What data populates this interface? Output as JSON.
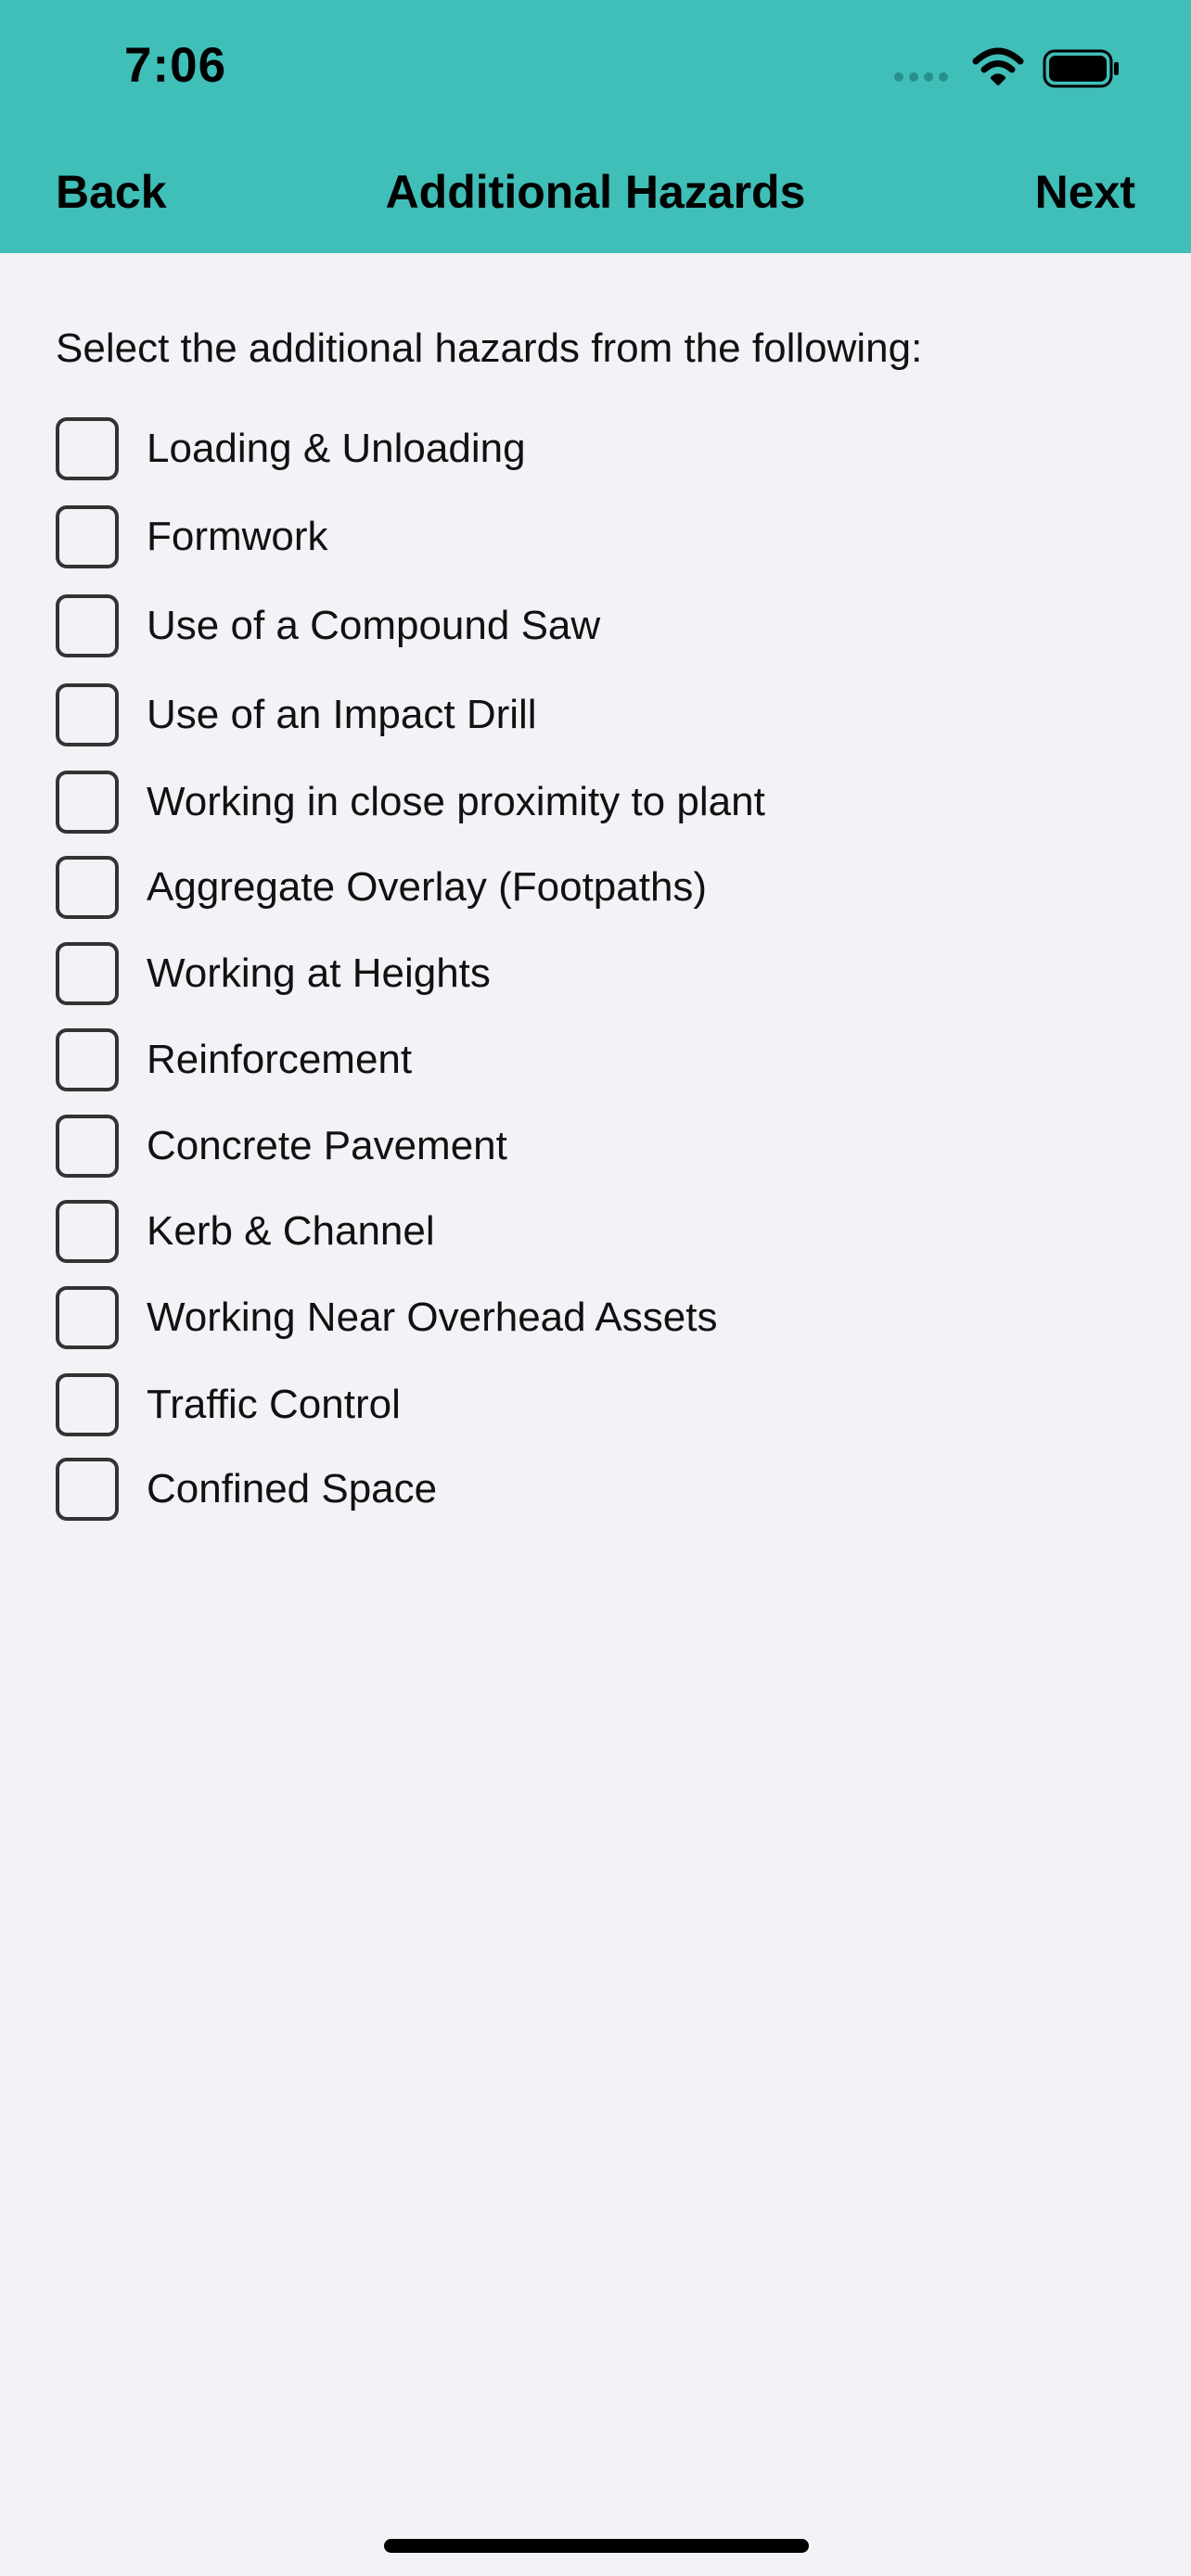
{
  "status_bar": {
    "time": "7:06",
    "icons": [
      "signal-icon",
      "wifi-icon",
      "battery-icon"
    ]
  },
  "nav": {
    "back_label": "Back",
    "title": "Additional Hazards",
    "next_label": "Next"
  },
  "instruction": "Select the additional hazards from the following:",
  "hazards": [
    {
      "label": "Loading & Unloading",
      "checked": false
    },
    {
      "label": "Formwork",
      "checked": false
    },
    {
      "label": "Use of a Compound Saw",
      "checked": false
    },
    {
      "label": "Use of an Impact Drill",
      "checked": false
    },
    {
      "label": "Working in close proximity to plant",
      "checked": false
    },
    {
      "label": "Aggregate Overlay (Footpaths)",
      "checked": false
    },
    {
      "label": "Working at Heights",
      "checked": false
    },
    {
      "label": "Reinforcement",
      "checked": false
    },
    {
      "label": "Concrete Pavement",
      "checked": false
    },
    {
      "label": "Kerb & Channel",
      "checked": false
    },
    {
      "label": "Working Near Overhead Assets",
      "checked": false
    },
    {
      "label": "Traffic Control",
      "checked": false
    },
    {
      "label": "Confined Space",
      "checked": false
    }
  ],
  "colors": {
    "header_bg": "#40beb8",
    "page_bg": "#f2f2f7"
  }
}
